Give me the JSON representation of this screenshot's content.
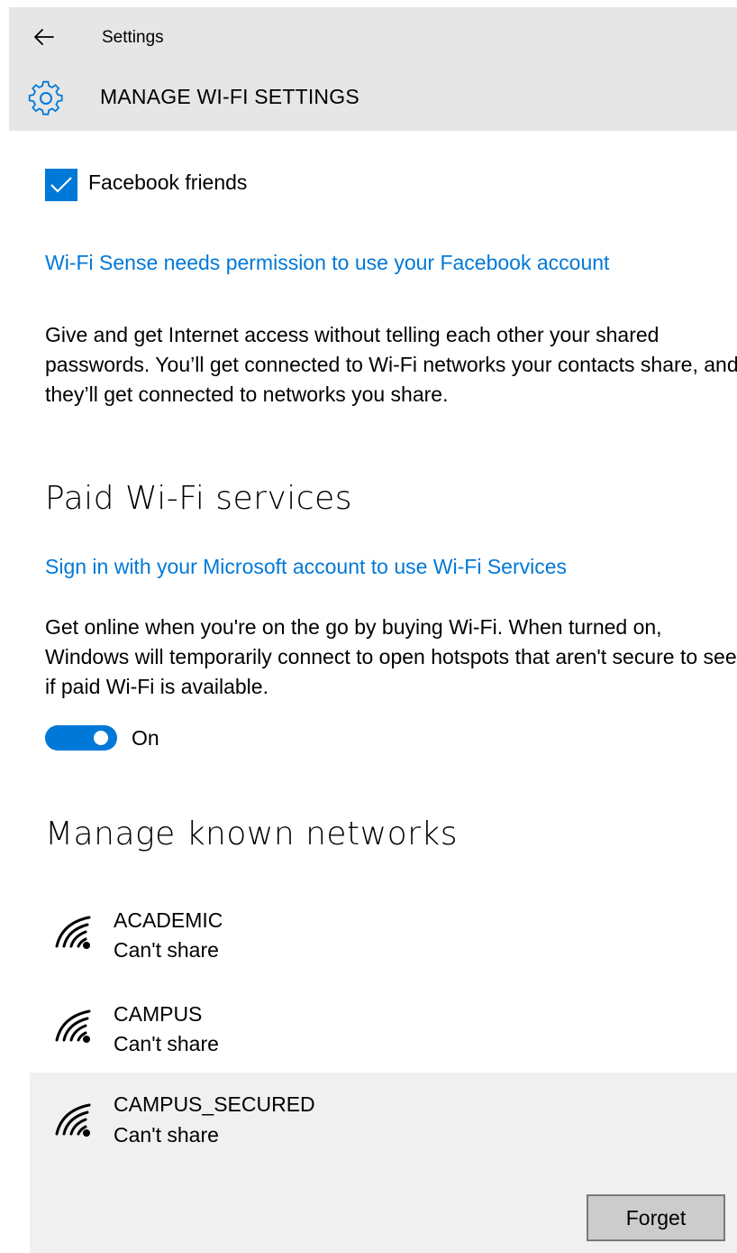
{
  "header": {
    "breadcrumb": "Settings",
    "title": "MANAGE WI-FI SETTINGS",
    "back_icon": "back-arrow-icon",
    "settings_icon": "gear-icon"
  },
  "facebook": {
    "checkbox_label": "Facebook friends",
    "checked": true,
    "permission_link": "Wi-Fi Sense needs permission to use your Facebook account",
    "description": "Give and get Internet access without telling each other your shared passwords. You’ll get connected to Wi-Fi networks your contacts share, and they’ll get connected to networks you share."
  },
  "paid": {
    "title": "Paid Wi-Fi services",
    "signin_link": "Sign in with your Microsoft account to use Wi-Fi Services",
    "description": "Get online when you're on the go by buying Wi-Fi. When turned on, Windows will temporarily connect to open hotspots that aren't secure to see if paid Wi-Fi is available.",
    "toggle_label": "On",
    "toggle_on": true
  },
  "known": {
    "title": "Manage known networks",
    "networks": [
      {
        "name": "ACADEMIC",
        "status": "Can't share",
        "icon": "wifi-signal-icon"
      },
      {
        "name": "CAMPUS",
        "status": "Can't share",
        "icon": "wifi-signal-icon"
      },
      {
        "name": "CAMPUS_SECURED",
        "status": "Can't share",
        "icon": "wifi-signal-icon",
        "selected": true
      }
    ],
    "forget_label": "Forget"
  },
  "colors": {
    "accent": "#0078d7",
    "header_bg": "#e6e6e6",
    "selected_bg": "#f0f0f0",
    "button_bg": "#cccccc"
  }
}
